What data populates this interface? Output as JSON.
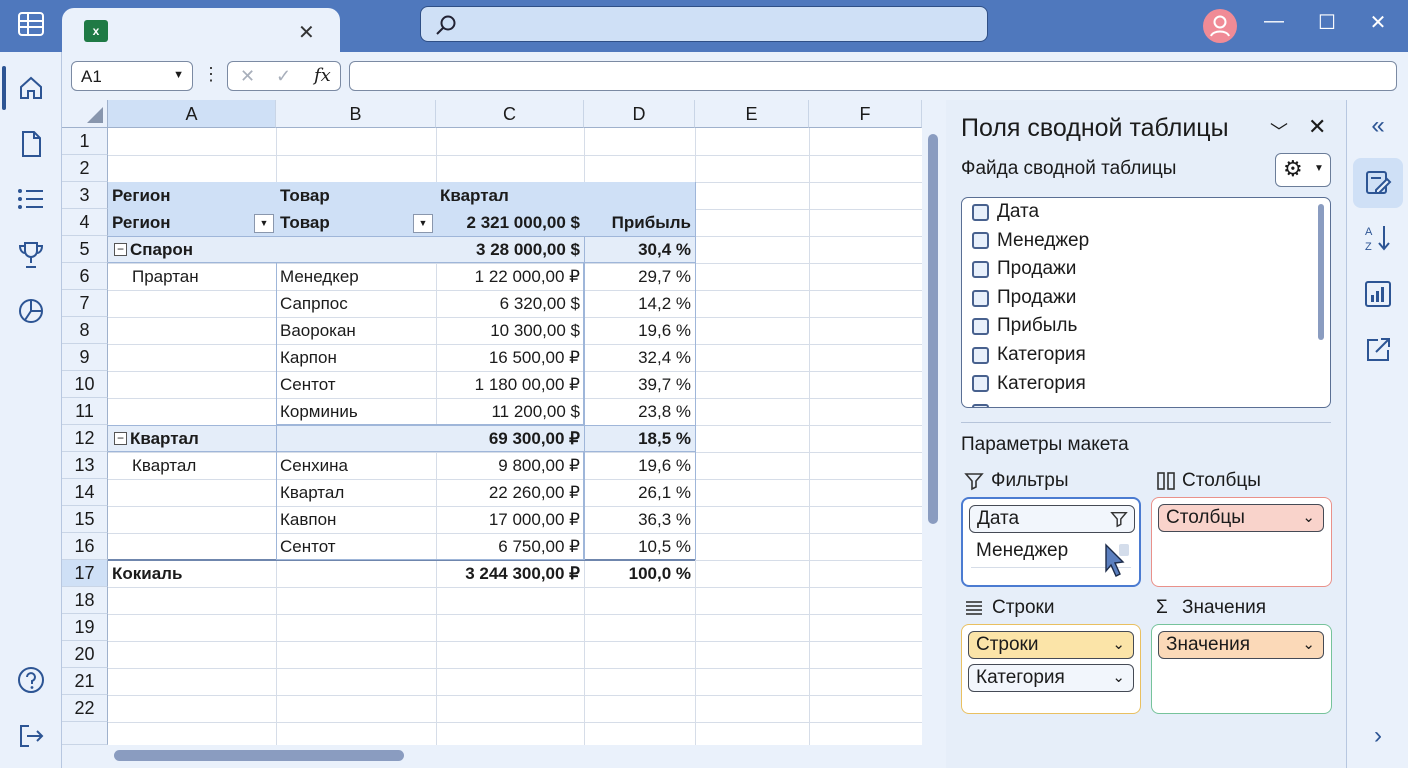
{
  "window": {
    "tab_title": "",
    "close_tab": "✕",
    "minimize": "—",
    "maximize": "☐",
    "close": "✕",
    "app_icon": "excel-icon",
    "avatar_icon": "user-icon"
  },
  "formula_bar": {
    "name_box": "A1",
    "more": "⋮",
    "cancel": "✕",
    "enter": "✓",
    "fx": "fx",
    "formula": ""
  },
  "sheet": {
    "columns": [
      "A",
      "B",
      "C",
      "D",
      "E",
      "F"
    ],
    "rows": [
      "1",
      "2",
      "3",
      "4",
      "5",
      "6",
      "7",
      "8",
      "9",
      "10",
      "11",
      "12",
      "13",
      "14",
      "15",
      "16",
      "17",
      "18",
      "19",
      "20",
      "21",
      "22"
    ],
    "header_row3": {
      "a": "Регион",
      "b": "Товар",
      "c": "Квартал"
    },
    "header_row4": {
      "a": "Регион",
      "b": "Товар",
      "c": "2 321 000,00 $",
      "d": "Прибыль"
    },
    "group1": {
      "label": "Спарон",
      "c": "3 28 000,00 $",
      "d": "30,4 %",
      "sub": "Прартан"
    },
    "group1_rows": [
      {
        "b": "Менедкер",
        "c": "1 22 000,00 ₽",
        "d": "29,7 %"
      },
      {
        "b": "Сапрпос",
        "c": "6 320,00 $",
        "d": "14,2 %"
      },
      {
        "b": "Ваорокан",
        "c": "10 300,00 $",
        "d": "19,6 %"
      },
      {
        "b": "Карпон",
        "c": "16 500,00 ₽",
        "d": "32,4 %"
      },
      {
        "b": "Сентот",
        "c": "1 180 00,00 ₽",
        "d": "39,7 %"
      },
      {
        "b": "Корминиь",
        "c": "11 200,00 $",
        "d": "23,8 %"
      }
    ],
    "group2": {
      "label": "Квартал",
      "c": "69 300,00 ₽",
      "d": "18,5 %",
      "sub": "Квартал"
    },
    "group2_rows": [
      {
        "b": "Сенхина",
        "c": "9 800,00 ₽",
        "d": "19,6 %"
      },
      {
        "b": "Квартал",
        "c": "22 260,00 ₽",
        "d": "26,1 %"
      },
      {
        "b": "Кавпон",
        "c": "17 000,00 ₽",
        "d": "36,3 %"
      },
      {
        "b": "Сентот",
        "c": "6 750,00 ₽",
        "d": "10,5 %"
      }
    ],
    "total": {
      "a": "Кокиаль",
      "c": "3 244 300,00 ₽",
      "d": "100,0 %"
    }
  },
  "panel": {
    "title": "Поля сводной таблицы",
    "subtitle": "Файда сводной таблицы",
    "fields": [
      "Дата",
      "Менеджер",
      "Продажи",
      "Продажи",
      "Прибыль",
      "Категория",
      "Категория"
    ],
    "layout_title": "Параметры макета",
    "filters_label": "Фильтры",
    "columns_label": "Столбцы",
    "rows_label": "Строки",
    "values_label": "Значения",
    "filters_chip": "Дата",
    "filters_drag": "Менеджер",
    "columns_chip": "Столбцы",
    "rows_chip1": "Строки",
    "rows_chip2": "Категория",
    "values_chip": "Значения",
    "colors": {
      "columns": "#f9d3cb",
      "rows": "#fbe4a8",
      "values": "#fbd9b8",
      "filters_border": "#4b7bd1",
      "columns_border": "#e9918a",
      "rows_border": "#e9c061",
      "values_border": "#76c39b"
    }
  }
}
